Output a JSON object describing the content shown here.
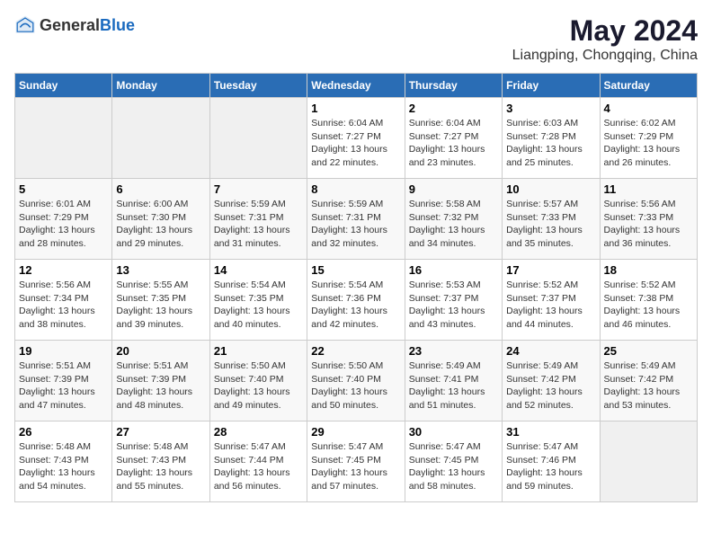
{
  "header": {
    "logo_general": "General",
    "logo_blue": "Blue",
    "title": "May 2024",
    "subtitle": "Liangping, Chongqing, China"
  },
  "days_of_week": [
    "Sunday",
    "Monday",
    "Tuesday",
    "Wednesday",
    "Thursday",
    "Friday",
    "Saturday"
  ],
  "weeks": [
    [
      {
        "num": "",
        "info": ""
      },
      {
        "num": "",
        "info": ""
      },
      {
        "num": "",
        "info": ""
      },
      {
        "num": "1",
        "info": "Sunrise: 6:04 AM\nSunset: 7:27 PM\nDaylight: 13 hours\nand 22 minutes."
      },
      {
        "num": "2",
        "info": "Sunrise: 6:04 AM\nSunset: 7:27 PM\nDaylight: 13 hours\nand 23 minutes."
      },
      {
        "num": "3",
        "info": "Sunrise: 6:03 AM\nSunset: 7:28 PM\nDaylight: 13 hours\nand 25 minutes."
      },
      {
        "num": "4",
        "info": "Sunrise: 6:02 AM\nSunset: 7:29 PM\nDaylight: 13 hours\nand 26 minutes."
      }
    ],
    [
      {
        "num": "5",
        "info": "Sunrise: 6:01 AM\nSunset: 7:29 PM\nDaylight: 13 hours\nand 28 minutes."
      },
      {
        "num": "6",
        "info": "Sunrise: 6:00 AM\nSunset: 7:30 PM\nDaylight: 13 hours\nand 29 minutes."
      },
      {
        "num": "7",
        "info": "Sunrise: 5:59 AM\nSunset: 7:31 PM\nDaylight: 13 hours\nand 31 minutes."
      },
      {
        "num": "8",
        "info": "Sunrise: 5:59 AM\nSunset: 7:31 PM\nDaylight: 13 hours\nand 32 minutes."
      },
      {
        "num": "9",
        "info": "Sunrise: 5:58 AM\nSunset: 7:32 PM\nDaylight: 13 hours\nand 34 minutes."
      },
      {
        "num": "10",
        "info": "Sunrise: 5:57 AM\nSunset: 7:33 PM\nDaylight: 13 hours\nand 35 minutes."
      },
      {
        "num": "11",
        "info": "Sunrise: 5:56 AM\nSunset: 7:33 PM\nDaylight: 13 hours\nand 36 minutes."
      }
    ],
    [
      {
        "num": "12",
        "info": "Sunrise: 5:56 AM\nSunset: 7:34 PM\nDaylight: 13 hours\nand 38 minutes."
      },
      {
        "num": "13",
        "info": "Sunrise: 5:55 AM\nSunset: 7:35 PM\nDaylight: 13 hours\nand 39 minutes."
      },
      {
        "num": "14",
        "info": "Sunrise: 5:54 AM\nSunset: 7:35 PM\nDaylight: 13 hours\nand 40 minutes."
      },
      {
        "num": "15",
        "info": "Sunrise: 5:54 AM\nSunset: 7:36 PM\nDaylight: 13 hours\nand 42 minutes."
      },
      {
        "num": "16",
        "info": "Sunrise: 5:53 AM\nSunset: 7:37 PM\nDaylight: 13 hours\nand 43 minutes."
      },
      {
        "num": "17",
        "info": "Sunrise: 5:52 AM\nSunset: 7:37 PM\nDaylight: 13 hours\nand 44 minutes."
      },
      {
        "num": "18",
        "info": "Sunrise: 5:52 AM\nSunset: 7:38 PM\nDaylight: 13 hours\nand 46 minutes."
      }
    ],
    [
      {
        "num": "19",
        "info": "Sunrise: 5:51 AM\nSunset: 7:39 PM\nDaylight: 13 hours\nand 47 minutes."
      },
      {
        "num": "20",
        "info": "Sunrise: 5:51 AM\nSunset: 7:39 PM\nDaylight: 13 hours\nand 48 minutes."
      },
      {
        "num": "21",
        "info": "Sunrise: 5:50 AM\nSunset: 7:40 PM\nDaylight: 13 hours\nand 49 minutes."
      },
      {
        "num": "22",
        "info": "Sunrise: 5:50 AM\nSunset: 7:40 PM\nDaylight: 13 hours\nand 50 minutes."
      },
      {
        "num": "23",
        "info": "Sunrise: 5:49 AM\nSunset: 7:41 PM\nDaylight: 13 hours\nand 51 minutes."
      },
      {
        "num": "24",
        "info": "Sunrise: 5:49 AM\nSunset: 7:42 PM\nDaylight: 13 hours\nand 52 minutes."
      },
      {
        "num": "25",
        "info": "Sunrise: 5:49 AM\nSunset: 7:42 PM\nDaylight: 13 hours\nand 53 minutes."
      }
    ],
    [
      {
        "num": "26",
        "info": "Sunrise: 5:48 AM\nSunset: 7:43 PM\nDaylight: 13 hours\nand 54 minutes."
      },
      {
        "num": "27",
        "info": "Sunrise: 5:48 AM\nSunset: 7:43 PM\nDaylight: 13 hours\nand 55 minutes."
      },
      {
        "num": "28",
        "info": "Sunrise: 5:47 AM\nSunset: 7:44 PM\nDaylight: 13 hours\nand 56 minutes."
      },
      {
        "num": "29",
        "info": "Sunrise: 5:47 AM\nSunset: 7:45 PM\nDaylight: 13 hours\nand 57 minutes."
      },
      {
        "num": "30",
        "info": "Sunrise: 5:47 AM\nSunset: 7:45 PM\nDaylight: 13 hours\nand 58 minutes."
      },
      {
        "num": "31",
        "info": "Sunrise: 5:47 AM\nSunset: 7:46 PM\nDaylight: 13 hours\nand 59 minutes."
      },
      {
        "num": "",
        "info": ""
      }
    ]
  ]
}
